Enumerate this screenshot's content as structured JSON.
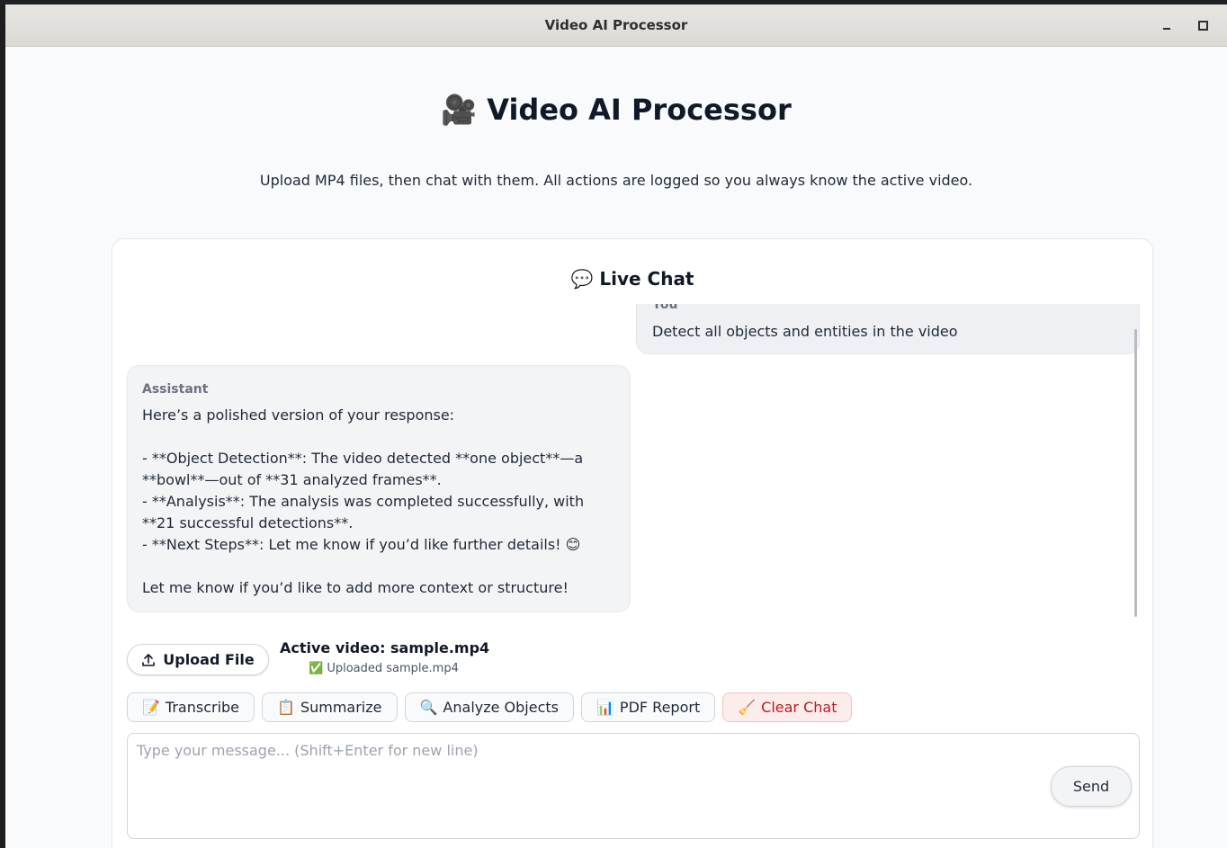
{
  "window": {
    "title": "Video AI Processor"
  },
  "header": {
    "icon": "movie-camera-icon",
    "icon_glyph": "🎥",
    "title": "Video AI Processor",
    "subtitle": "Upload MP4 files, then chat with them. All actions are logged so you always know the active video."
  },
  "chat": {
    "icon_glyph": "💬",
    "title": "Live Chat",
    "messages": [
      {
        "role": "You",
        "text": "Detect all objects and entities in the video"
      },
      {
        "role": "Assistant",
        "lines": [
          "Here’s a polished version of your response:",
          "",
          "- **Object Detection**: The video detected **one object**—a",
          "**bowl**—out of **31 analyzed frames**.",
          "- **Analysis**: The analysis was completed successfully, with",
          "**21 successful detections**.",
          "- **Next Steps**: Let me know if you’d like further details! 😊",
          "",
          "Let me know if you’d like to add more context or structure!"
        ]
      }
    ]
  },
  "upload": {
    "button_label": "Upload File",
    "active_video": "Active video: sample.mp4",
    "status_glyph": "✅",
    "status_text": "Uploaded sample.mp4"
  },
  "actions": [
    {
      "glyph": "📝",
      "label": "Transcribe"
    },
    {
      "glyph": "📋",
      "label": "Summarize"
    },
    {
      "glyph": "🔍",
      "label": "Analyze Objects"
    },
    {
      "glyph": "📊",
      "label": "PDF Report"
    },
    {
      "glyph": "🧹",
      "label": "Clear Chat"
    }
  ],
  "composer": {
    "placeholder": "Type your message... (Shift+Enter for new line)",
    "value": "",
    "send_label": "Send"
  },
  "colors": {
    "danger": "#b91c1c",
    "danger_bg": "#fdecec",
    "bubble": "#f3f4f6"
  }
}
